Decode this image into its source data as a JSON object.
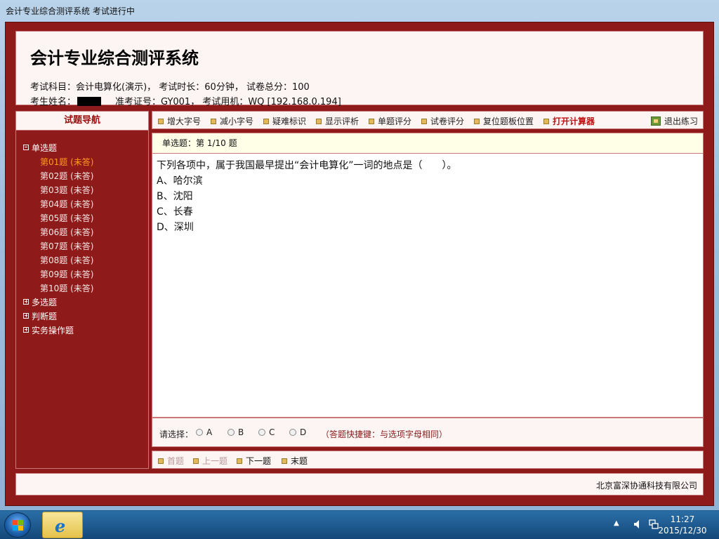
{
  "window": {
    "title": "会计专业综合测评系统 考试进行中"
  },
  "header": {
    "system_name": "会计专业综合测评系统",
    "line1": "考试科目：会计电算化(演示)， 考试时长：60分钟， 试卷总分：100",
    "candidate_label": "考生姓名：",
    "exam_id": "准考证号：GY001， 考试用机：WQ [192.168.0.194]"
  },
  "nav": {
    "title": "试题导航",
    "groups": [
      {
        "label": "单选题",
        "expanded": true
      },
      {
        "label": "多选题",
        "expanded": false
      },
      {
        "label": "判断题",
        "expanded": false
      },
      {
        "label": "实务操作题",
        "expanded": false
      }
    ],
    "questions": [
      "第01题 (未答)",
      "第02题 (未答)",
      "第03题 (未答)",
      "第04题 (未答)",
      "第05题 (未答)",
      "第06题 (未答)",
      "第07题 (未答)",
      "第08题 (未答)",
      "第09题 (未答)",
      "第10题 (未答)"
    ]
  },
  "toolbar": {
    "increase_font": "增大字号",
    "decrease_font": "减小字号",
    "mark_difficult": "疑难标识",
    "show_analysis": "显示评析",
    "score_question": "单题评分",
    "score_paper": "试卷评分",
    "reset_panel": "复位题板位置",
    "open_calculator": "打开计算器",
    "exit_practice": "退出练习"
  },
  "question": {
    "header": "单选题：第 1/10 题",
    "stem": "下列各项中，属于我国最早提出“会计电算化”一词的地点是（　　）。",
    "options": [
      "A、哈尔滨",
      "B、沈阳",
      "C、长春",
      "D、深圳"
    ]
  },
  "answer": {
    "label": "请选择：",
    "choices": [
      "A",
      "B",
      "C",
      "D"
    ],
    "hint": "（答题快捷键：与选项字母相同）"
  },
  "pager": {
    "first": "首题",
    "prev": "上一题",
    "next": "下一题",
    "last": "末题"
  },
  "footer": {
    "company": "北京富深协通科技有限公司"
  },
  "taskbar": {
    "time": "11:27",
    "date": "2015/12/30",
    "tray_arrow": "▲"
  },
  "colors": {
    "frame": "#8f1a1a",
    "panel": "#fdf4f4",
    "active_question": "#ff9a1e",
    "calculator": "#c01010"
  }
}
